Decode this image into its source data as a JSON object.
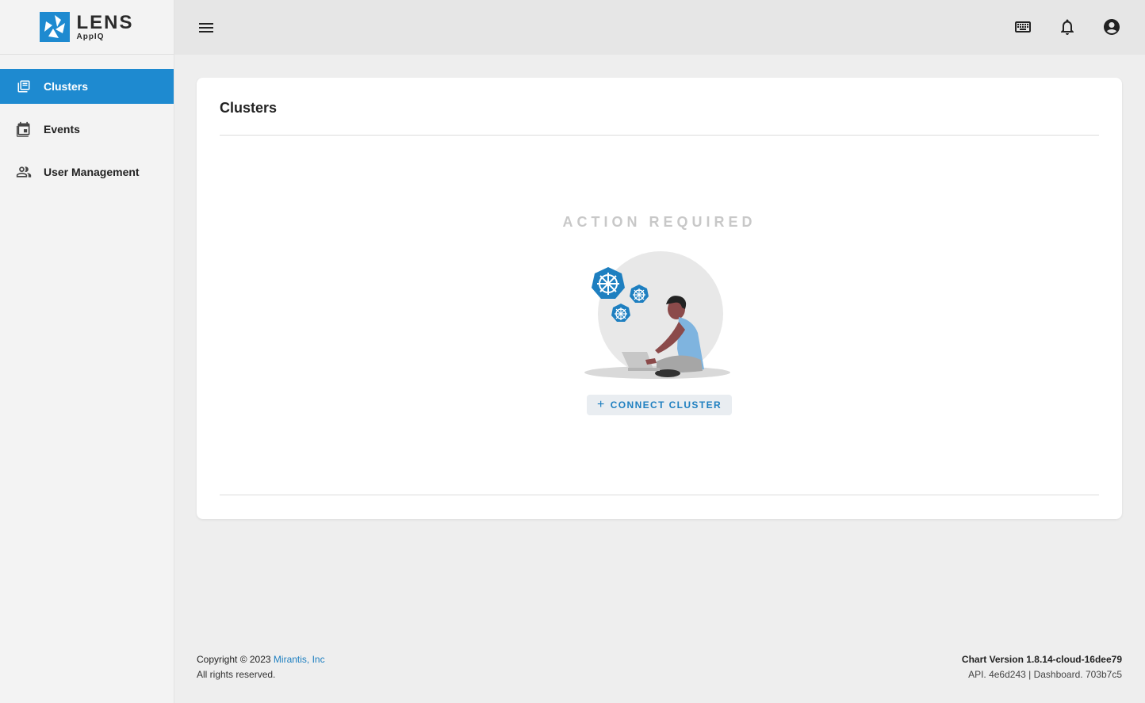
{
  "brand": {
    "name": "LENS",
    "sub": "AppIQ"
  },
  "sidebar": {
    "items": [
      {
        "label": "Clusters",
        "icon": "clusters-icon",
        "active": true
      },
      {
        "label": "Events",
        "icon": "calendar-icon",
        "active": false
      },
      {
        "label": "User Management",
        "icon": "users-icon",
        "active": false
      }
    ]
  },
  "topbar": {
    "icons": [
      "keyboard-icon",
      "bell-icon",
      "account-icon"
    ]
  },
  "main": {
    "title": "Clusters",
    "empty_state": "ACTION REQUIRED",
    "connect_label": "CONNECT CLUSTER"
  },
  "footer": {
    "copyright": "Copyright © 2023",
    "company": "Mirantis, Inc",
    "rights": "All rights reserved.",
    "chart_version": "Chart Version 1.8.14-cloud-16dee79",
    "api": "API. 4e6d243 | Dashboard. 703b7c5"
  },
  "colors": {
    "accent": "#1e8ad0",
    "link": "#1e7fc0"
  }
}
